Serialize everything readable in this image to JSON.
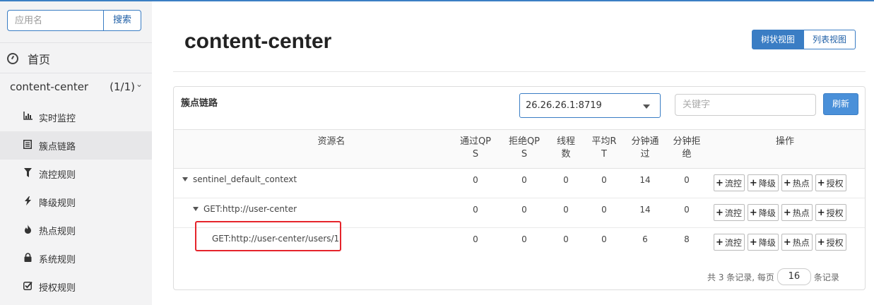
{
  "sidebar": {
    "search_placeholder": "应用名",
    "search_button": "搜索",
    "home_label": "首页",
    "app_name": "content-center",
    "app_count": "(1/1)",
    "items": [
      {
        "label": "实时监控",
        "icon": "bar-chart-icon"
      },
      {
        "label": "簇点链路",
        "icon": "list-icon"
      },
      {
        "label": "流控规则",
        "icon": "filter-icon"
      },
      {
        "label": "降级规则",
        "icon": "bolt-icon"
      },
      {
        "label": "热点规则",
        "icon": "fire-icon"
      },
      {
        "label": "系统规则",
        "icon": "lock-icon"
      },
      {
        "label": "授权规则",
        "icon": "check-icon"
      }
    ]
  },
  "main": {
    "title": "content-center",
    "view_tree": "树状视图",
    "view_list": "列表视图"
  },
  "panel": {
    "title": "簇点链路",
    "machine": "26.26.26.1:8719",
    "keyword_placeholder": "关键字",
    "refresh": "刷新"
  },
  "table": {
    "headers": {
      "resource": "资源名",
      "pass_qps_1": "通过QP",
      "pass_qps_2": "S",
      "block_qps_1": "拒绝QP",
      "block_qps_2": "S",
      "threads_1": "线程",
      "threads_2": "数",
      "avg_rt_1": "平均R",
      "avg_rt_2": "T",
      "min_pass_1": "分钟通",
      "min_pass_2": "过",
      "min_block_1": "分钟拒",
      "min_block_2": "绝",
      "ops": "操作"
    },
    "rows": [
      {
        "name": "sentinel_default_context",
        "pass": "0",
        "block": "0",
        "threads": "0",
        "rt": "0",
        "min_pass": "14",
        "min_block": "0"
      },
      {
        "name": "GET:http://user-center",
        "pass": "0",
        "block": "0",
        "threads": "0",
        "rt": "0",
        "min_pass": "14",
        "min_block": "0"
      },
      {
        "name": "GET:http://user-center/users/1",
        "pass": "0",
        "block": "0",
        "threads": "0",
        "rt": "0",
        "min_pass": "6",
        "min_block": "8"
      }
    ],
    "op_labels": {
      "flow": "流控",
      "degrade": "降级",
      "hot": "热点",
      "auth": "授权"
    }
  },
  "footer": {
    "prefix": "共 3 条记录, 每页",
    "page_size": "16",
    "suffix": "条记录"
  },
  "colors": {
    "accent": "#3a7dc4",
    "highlight": "#e5242b"
  }
}
